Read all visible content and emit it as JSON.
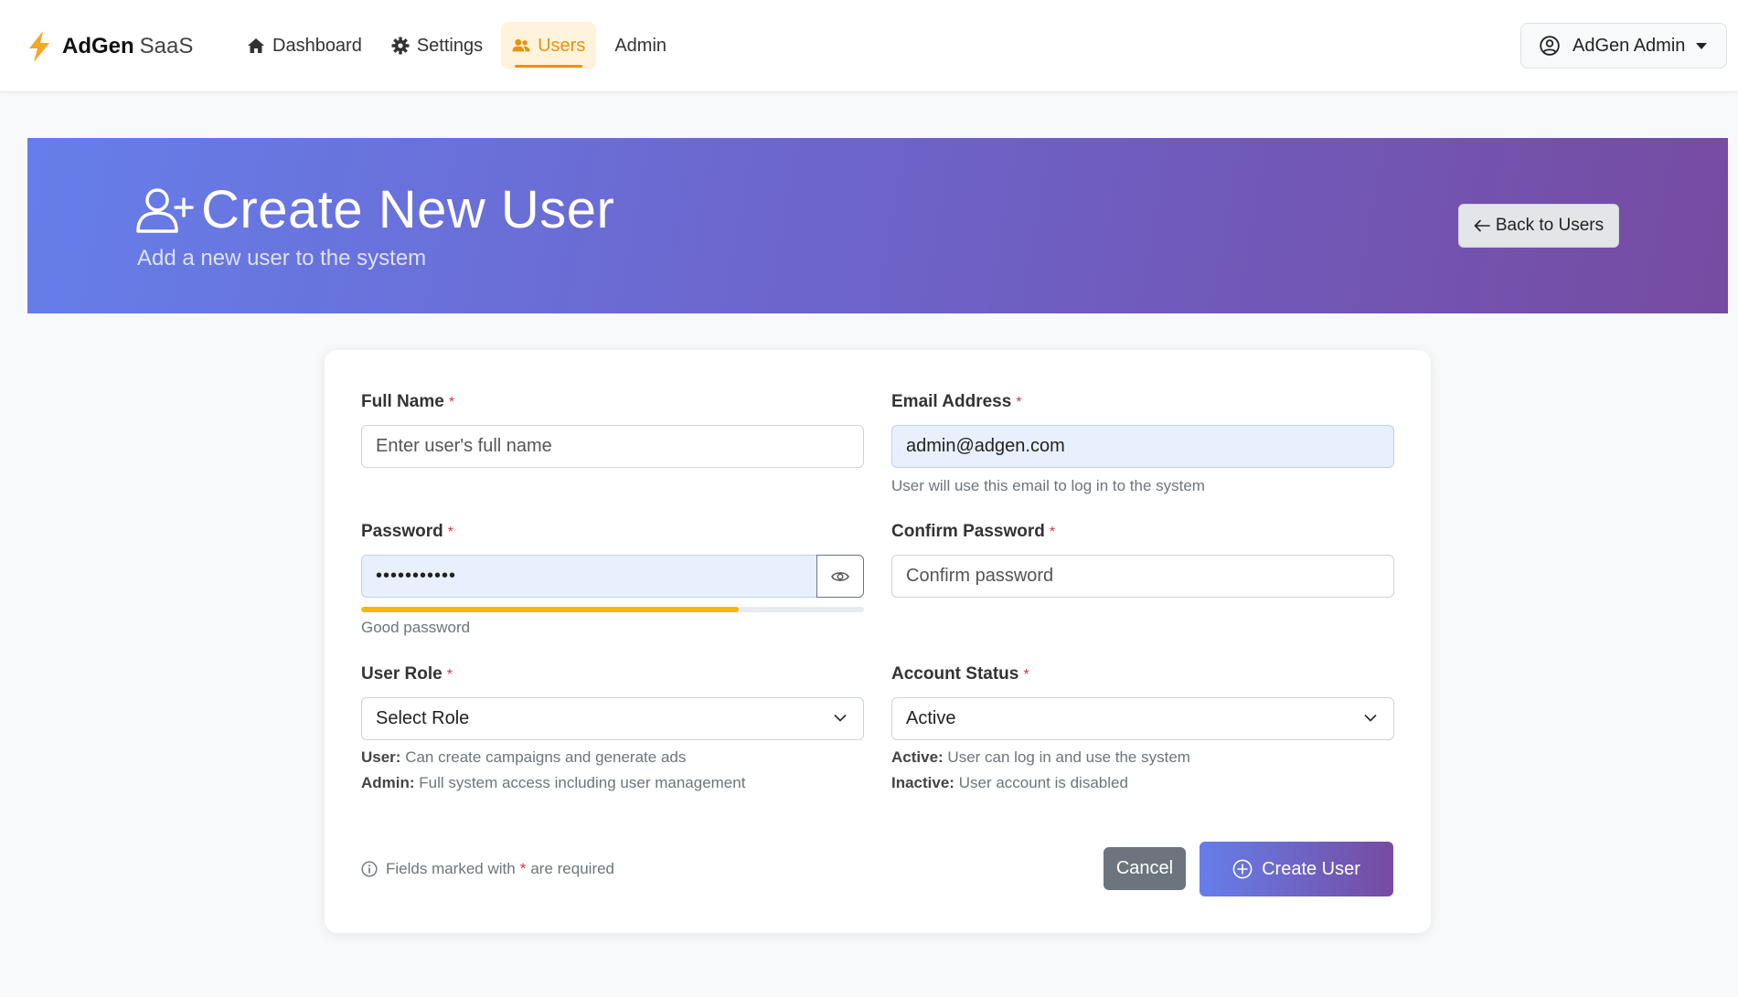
{
  "brand": {
    "strong": "AdGen",
    "light": "SaaS"
  },
  "nav": {
    "items": [
      {
        "label": "Dashboard",
        "icon": "house-icon"
      },
      {
        "label": "Settings",
        "icon": "gear-icon"
      },
      {
        "label": "Users",
        "icon": "users-icon",
        "active": true
      },
      {
        "label": "Admin"
      }
    ]
  },
  "user_menu": {
    "label": "AdGen Admin",
    "icon": "user-circle-icon"
  },
  "header": {
    "title": "Create New User",
    "subtitle": "Add a new user to the system",
    "back_label": "Back to Users"
  },
  "form": {
    "full_name": {
      "label": "Full Name",
      "placeholder": "Enter user's full name",
      "value": ""
    },
    "email": {
      "label": "Email Address",
      "value": "admin@adgen.com",
      "help": "User will use this email to log in to the system"
    },
    "password": {
      "label": "Password",
      "value": "•••••••••••",
      "strength_label": "Good password",
      "strength_fraction": 0.75
    },
    "confirm_password": {
      "label": "Confirm Password",
      "placeholder": "Confirm password",
      "value": ""
    },
    "role": {
      "label": "User Role",
      "selected": "Select Role",
      "help": [
        {
          "term": "User:",
          "desc": "Can create campaigns and generate ads"
        },
        {
          "term": "Admin:",
          "desc": "Full system access including user management"
        }
      ]
    },
    "status": {
      "label": "Account Status",
      "selected": "Active",
      "help": [
        {
          "term": "Active:",
          "desc": "User can log in and use the system"
        },
        {
          "term": "Inactive:",
          "desc": "User account is disabled"
        }
      ]
    },
    "required_marker": "*",
    "note_before": "Fields marked with",
    "note_after": "are required",
    "cancel_label": "Cancel",
    "create_label": "Create User"
  },
  "colors": {
    "accent": "#e8930c",
    "gradient_start": "#667eea",
    "gradient_end": "#764ba2",
    "required": "#dc3545",
    "strength": "#f5b800"
  }
}
